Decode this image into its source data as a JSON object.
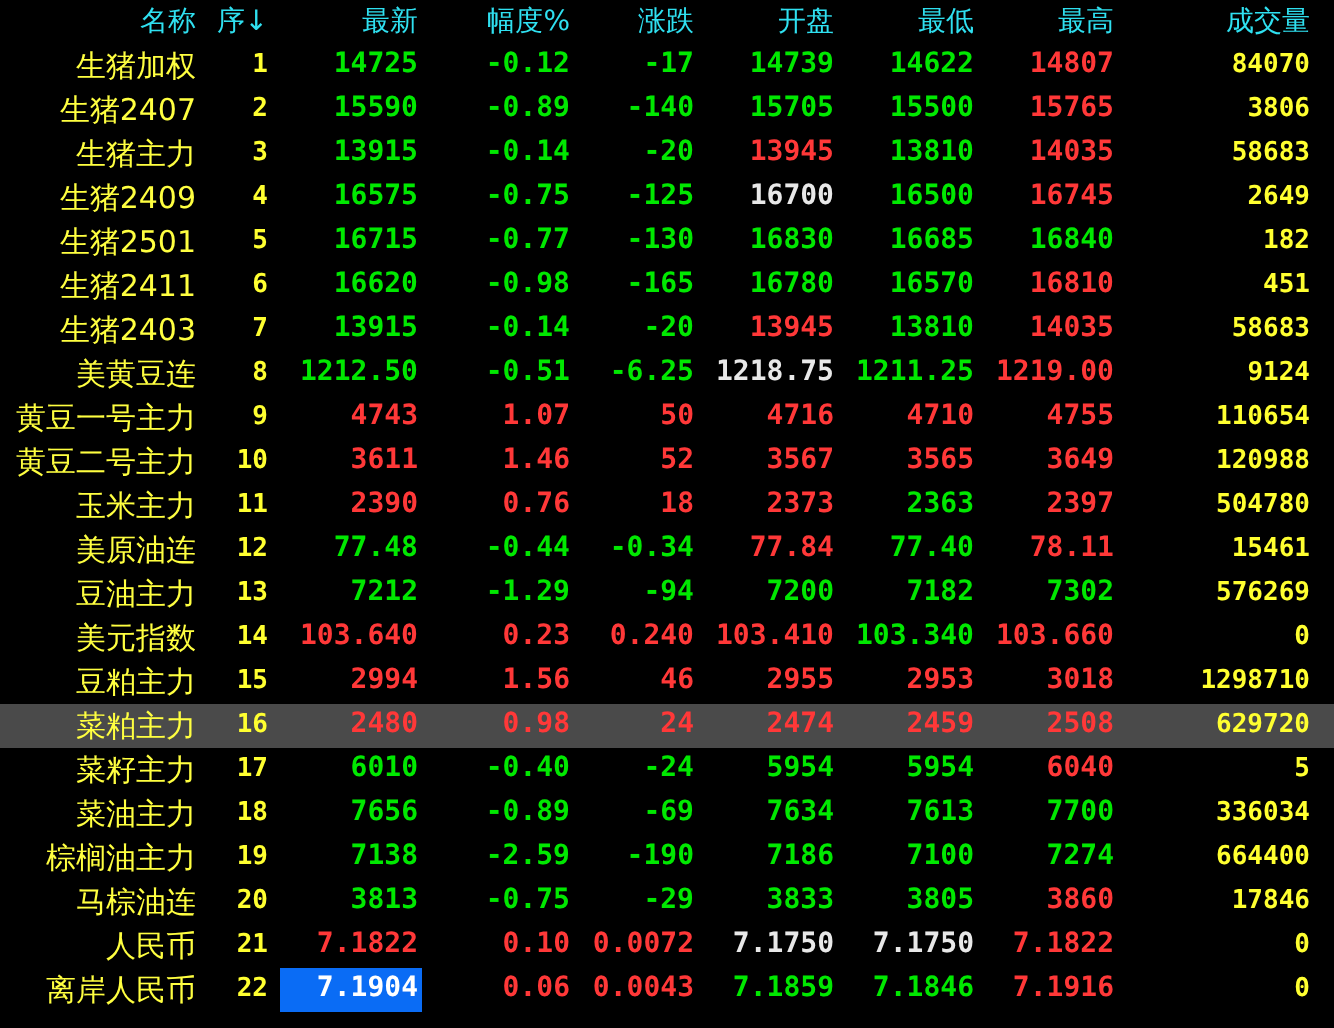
{
  "columns": [
    {
      "label": "名称"
    },
    {
      "label": "序↓"
    },
    {
      "label": "最新"
    },
    {
      "label": "幅度%"
    },
    {
      "label": "涨跌"
    },
    {
      "label": "开盘"
    },
    {
      "label": "最低"
    },
    {
      "label": "最高"
    },
    {
      "label": "成交量"
    }
  ],
  "rows": [
    {
      "name": "生猪加权",
      "index": "1",
      "selected": false,
      "latest_focused": false,
      "cells": [
        {
          "text": "14725",
          "color": "#00e800"
        },
        {
          "text": "-0.12",
          "color": "#00e800"
        },
        {
          "text": "-17",
          "color": "#00e800"
        },
        {
          "text": "14739",
          "color": "#00e800"
        },
        {
          "text": "14622",
          "color": "#00e800"
        },
        {
          "text": "14807",
          "color": "#ff3838"
        }
      ],
      "volume": "84070"
    },
    {
      "name": "生猪2407",
      "index": "2",
      "selected": false,
      "latest_focused": false,
      "cells": [
        {
          "text": "15590",
          "color": "#00e800"
        },
        {
          "text": "-0.89",
          "color": "#00e800"
        },
        {
          "text": "-140",
          "color": "#00e800"
        },
        {
          "text": "15705",
          "color": "#00e800"
        },
        {
          "text": "15500",
          "color": "#00e800"
        },
        {
          "text": "15765",
          "color": "#ff3838"
        }
      ],
      "volume": "3806"
    },
    {
      "name": "生猪主力",
      "index": "3",
      "selected": false,
      "latest_focused": false,
      "cells": [
        {
          "text": "13915",
          "color": "#00e800"
        },
        {
          "text": "-0.14",
          "color": "#00e800"
        },
        {
          "text": "-20",
          "color": "#00e800"
        },
        {
          "text": "13945",
          "color": "#ff3838"
        },
        {
          "text": "13810",
          "color": "#00e800"
        },
        {
          "text": "14035",
          "color": "#ff3838"
        }
      ],
      "volume": "58683"
    },
    {
      "name": "生猪2409",
      "index": "4",
      "selected": false,
      "latest_focused": false,
      "cells": [
        {
          "text": "16575",
          "color": "#00e800"
        },
        {
          "text": "-0.75",
          "color": "#00e800"
        },
        {
          "text": "-125",
          "color": "#00e800"
        },
        {
          "text": "16700",
          "color": "#e8e8e8"
        },
        {
          "text": "16500",
          "color": "#00e800"
        },
        {
          "text": "16745",
          "color": "#ff3838"
        }
      ],
      "volume": "2649"
    },
    {
      "name": "生猪2501",
      "index": "5",
      "selected": false,
      "latest_focused": false,
      "cells": [
        {
          "text": "16715",
          "color": "#00e800"
        },
        {
          "text": "-0.77",
          "color": "#00e800"
        },
        {
          "text": "-130",
          "color": "#00e800"
        },
        {
          "text": "16830",
          "color": "#00e800"
        },
        {
          "text": "16685",
          "color": "#00e800"
        },
        {
          "text": "16840",
          "color": "#00e800"
        }
      ],
      "volume": "182"
    },
    {
      "name": "生猪2411",
      "index": "6",
      "selected": false,
      "latest_focused": false,
      "cells": [
        {
          "text": "16620",
          "color": "#00e800"
        },
        {
          "text": "-0.98",
          "color": "#00e800"
        },
        {
          "text": "-165",
          "color": "#00e800"
        },
        {
          "text": "16780",
          "color": "#00e800"
        },
        {
          "text": "16570",
          "color": "#00e800"
        },
        {
          "text": "16810",
          "color": "#ff3838"
        }
      ],
      "volume": "451"
    },
    {
      "name": "生猪2403",
      "index": "7",
      "selected": false,
      "latest_focused": false,
      "cells": [
        {
          "text": "13915",
          "color": "#00e800"
        },
        {
          "text": "-0.14",
          "color": "#00e800"
        },
        {
          "text": "-20",
          "color": "#00e800"
        },
        {
          "text": "13945",
          "color": "#ff3838"
        },
        {
          "text": "13810",
          "color": "#00e800"
        },
        {
          "text": "14035",
          "color": "#ff3838"
        }
      ],
      "volume": "58683"
    },
    {
      "name": "美黄豆连",
      "index": "8",
      "selected": false,
      "latest_focused": false,
      "cells": [
        {
          "text": "1212.50",
          "color": "#00e800"
        },
        {
          "text": "-0.51",
          "color": "#00e800"
        },
        {
          "text": "-6.25",
          "color": "#00e800"
        },
        {
          "text": "1218.75",
          "color": "#e8e8e8"
        },
        {
          "text": "1211.25",
          "color": "#00e800"
        },
        {
          "text": "1219.00",
          "color": "#ff3838"
        }
      ],
      "volume": "9124"
    },
    {
      "name": "黄豆一号主力",
      "index": "9",
      "selected": false,
      "latest_focused": false,
      "cells": [
        {
          "text": "4743",
          "color": "#ff3838"
        },
        {
          "text": "1.07",
          "color": "#ff3838"
        },
        {
          "text": "50",
          "color": "#ff3838"
        },
        {
          "text": "4716",
          "color": "#ff3838"
        },
        {
          "text": "4710",
          "color": "#ff3838"
        },
        {
          "text": "4755",
          "color": "#ff3838"
        }
      ],
      "volume": "110654"
    },
    {
      "name": "黄豆二号主力",
      "index": "10",
      "selected": false,
      "latest_focused": false,
      "cells": [
        {
          "text": "3611",
          "color": "#ff3838"
        },
        {
          "text": "1.46",
          "color": "#ff3838"
        },
        {
          "text": "52",
          "color": "#ff3838"
        },
        {
          "text": "3567",
          "color": "#ff3838"
        },
        {
          "text": "3565",
          "color": "#ff3838"
        },
        {
          "text": "3649",
          "color": "#ff3838"
        }
      ],
      "volume": "120988"
    },
    {
      "name": "玉米主力",
      "index": "11",
      "selected": false,
      "latest_focused": false,
      "cells": [
        {
          "text": "2390",
          "color": "#ff3838"
        },
        {
          "text": "0.76",
          "color": "#ff3838"
        },
        {
          "text": "18",
          "color": "#ff3838"
        },
        {
          "text": "2373",
          "color": "#ff3838"
        },
        {
          "text": "2363",
          "color": "#00e800"
        },
        {
          "text": "2397",
          "color": "#ff3838"
        }
      ],
      "volume": "504780"
    },
    {
      "name": "美原油连",
      "index": "12",
      "selected": false,
      "latest_focused": false,
      "cells": [
        {
          "text": "77.48",
          "color": "#00e800"
        },
        {
          "text": "-0.44",
          "color": "#00e800"
        },
        {
          "text": "-0.34",
          "color": "#00e800"
        },
        {
          "text": "77.84",
          "color": "#ff3838"
        },
        {
          "text": "77.40",
          "color": "#00e800"
        },
        {
          "text": "78.11",
          "color": "#ff3838"
        }
      ],
      "volume": "15461"
    },
    {
      "name": "豆油主力",
      "index": "13",
      "selected": false,
      "latest_focused": false,
      "cells": [
        {
          "text": "7212",
          "color": "#00e800"
        },
        {
          "text": "-1.29",
          "color": "#00e800"
        },
        {
          "text": "-94",
          "color": "#00e800"
        },
        {
          "text": "7200",
          "color": "#00e800"
        },
        {
          "text": "7182",
          "color": "#00e800"
        },
        {
          "text": "7302",
          "color": "#00e800"
        }
      ],
      "volume": "576269"
    },
    {
      "name": "美元指数",
      "index": "14",
      "selected": false,
      "latest_focused": false,
      "cells": [
        {
          "text": "103.640",
          "color": "#ff3838"
        },
        {
          "text": "0.23",
          "color": "#ff3838"
        },
        {
          "text": "0.240",
          "color": "#ff3838"
        },
        {
          "text": "103.410",
          "color": "#ff3838"
        },
        {
          "text": "103.340",
          "color": "#00e800"
        },
        {
          "text": "103.660",
          "color": "#ff3838"
        }
      ],
      "volume": "0"
    },
    {
      "name": "豆粕主力",
      "index": "15",
      "selected": false,
      "latest_focused": false,
      "cells": [
        {
          "text": "2994",
          "color": "#ff3838"
        },
        {
          "text": "1.56",
          "color": "#ff3838"
        },
        {
          "text": "46",
          "color": "#ff3838"
        },
        {
          "text": "2955",
          "color": "#ff3838"
        },
        {
          "text": "2953",
          "color": "#ff3838"
        },
        {
          "text": "3018",
          "color": "#ff3838"
        }
      ],
      "volume": "1298710"
    },
    {
      "name": "菜粕主力",
      "index": "16",
      "selected": true,
      "latest_focused": false,
      "cells": [
        {
          "text": "2480",
          "color": "#ff3838"
        },
        {
          "text": "0.98",
          "color": "#ff3838"
        },
        {
          "text": "24",
          "color": "#ff3838"
        },
        {
          "text": "2474",
          "color": "#ff3838"
        },
        {
          "text": "2459",
          "color": "#ff3838"
        },
        {
          "text": "2508",
          "color": "#ff3838"
        }
      ],
      "volume": "629720"
    },
    {
      "name": "菜籽主力",
      "index": "17",
      "selected": false,
      "latest_focused": false,
      "cells": [
        {
          "text": "6010",
          "color": "#00e800"
        },
        {
          "text": "-0.40",
          "color": "#00e800"
        },
        {
          "text": "-24",
          "color": "#00e800"
        },
        {
          "text": "5954",
          "color": "#00e800"
        },
        {
          "text": "5954",
          "color": "#00e800"
        },
        {
          "text": "6040",
          "color": "#ff3838"
        }
      ],
      "volume": "5"
    },
    {
      "name": "菜油主力",
      "index": "18",
      "selected": false,
      "latest_focused": false,
      "cells": [
        {
          "text": "7656",
          "color": "#00e800"
        },
        {
          "text": "-0.89",
          "color": "#00e800"
        },
        {
          "text": "-69",
          "color": "#00e800"
        },
        {
          "text": "7634",
          "color": "#00e800"
        },
        {
          "text": "7613",
          "color": "#00e800"
        },
        {
          "text": "7700",
          "color": "#00e800"
        }
      ],
      "volume": "336034"
    },
    {
      "name": "棕榈油主力",
      "index": "19",
      "selected": false,
      "latest_focused": false,
      "cells": [
        {
          "text": "7138",
          "color": "#00e800"
        },
        {
          "text": "-2.59",
          "color": "#00e800"
        },
        {
          "text": "-190",
          "color": "#00e800"
        },
        {
          "text": "7186",
          "color": "#00e800"
        },
        {
          "text": "7100",
          "color": "#00e800"
        },
        {
          "text": "7274",
          "color": "#00e800"
        }
      ],
      "volume": "664400"
    },
    {
      "name": "马棕油连",
      "index": "20",
      "selected": false,
      "latest_focused": false,
      "cells": [
        {
          "text": "3813",
          "color": "#00e800"
        },
        {
          "text": "-0.75",
          "color": "#00e800"
        },
        {
          "text": "-29",
          "color": "#00e800"
        },
        {
          "text": "3833",
          "color": "#00e800"
        },
        {
          "text": "3805",
          "color": "#00e800"
        },
        {
          "text": "3860",
          "color": "#ff3838"
        }
      ],
      "volume": "17846"
    },
    {
      "name": "人民币",
      "index": "21",
      "selected": false,
      "latest_focused": false,
      "cells": [
        {
          "text": "7.1822",
          "color": "#ff3838"
        },
        {
          "text": "0.10",
          "color": "#ff3838"
        },
        {
          "text": "0.0072",
          "color": "#ff3838"
        },
        {
          "text": "7.1750",
          "color": "#e8e8e8"
        },
        {
          "text": "7.1750",
          "color": "#e8e8e8"
        },
        {
          "text": "7.1822",
          "color": "#ff3838"
        }
      ],
      "volume": "0"
    },
    {
      "name": "离岸人民币",
      "index": "22",
      "selected": false,
      "latest_focused": true,
      "cells": [
        {
          "text": "7.1904",
          "color": "#ffffff"
        },
        {
          "text": "0.06",
          "color": "#ff3838"
        },
        {
          "text": "0.0043",
          "color": "#ff3838"
        },
        {
          "text": "7.1859",
          "color": "#00e800"
        },
        {
          "text": "7.1846",
          "color": "#00e800"
        },
        {
          "text": "7.1916",
          "color": "#ff3838"
        }
      ],
      "volume": "0"
    }
  ]
}
